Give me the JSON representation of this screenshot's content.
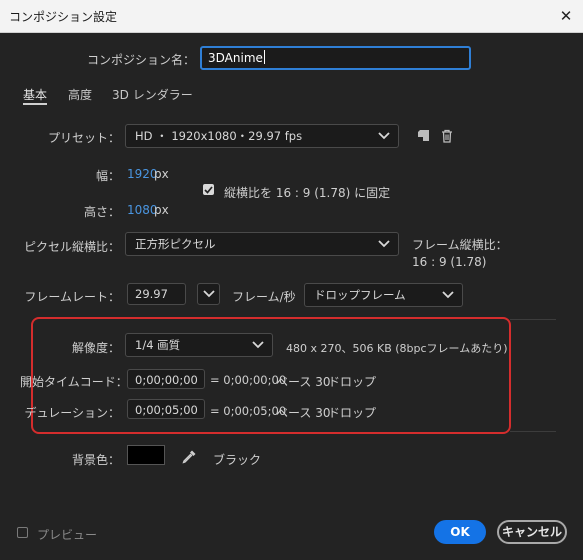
{
  "window": {
    "title": "コンポジション設定"
  },
  "comp_name": {
    "label": "コンポジション名：",
    "value": "3DAnime"
  },
  "tabs": [
    {
      "label": "基本",
      "active": true
    },
    {
      "label": "高度",
      "active": false
    },
    {
      "label": "3D レンダラー",
      "active": false
    }
  ],
  "preset": {
    "label": "プリセット：",
    "value": "HD ・ 1920x1080・29.97 fps"
  },
  "width": {
    "label": "幅：",
    "value": "1920",
    "unit": "px"
  },
  "height": {
    "label": "高さ：",
    "value": "1080",
    "unit": "px"
  },
  "lock_aspect": {
    "label": "縦横比を 16 : 9 (1.78) に固定",
    "checked": true
  },
  "pixel_aspect": {
    "label": "ピクセル縦横比：",
    "value": "正方形ピクセル"
  },
  "frame_aspect": {
    "label": "フレーム縦横比：",
    "value": "16 : 9 (1.78)"
  },
  "frame_rate": {
    "label": "フレームレート：",
    "value": "29.97",
    "unit": "フレーム/秒",
    "drop": "ドロップフレーム"
  },
  "resolution": {
    "label": "解像度：",
    "value": "1/4 画質",
    "info": "480 x 270、506 KB (8bpcフレームあたり)"
  },
  "start_tc": {
    "label": "開始タイムコード：",
    "value": "0;00;00;00",
    "readout": "= 0;00;00;00",
    "base": "ベース 30",
    "drop": "ドロップ"
  },
  "duration": {
    "label": "デュレーション：",
    "value": "0;00;05;00",
    "readout": "= 0;00;05;00",
    "base": "ベース 30",
    "drop": "ドロップ"
  },
  "bg_color": {
    "label": "背景色：",
    "name": "ブラック",
    "color": "#000000"
  },
  "preview": {
    "label": "プレビュー",
    "checked": false
  },
  "buttons": {
    "ok": "OK",
    "cancel": "キャンセル"
  },
  "colors": {
    "accent": "#1473e6",
    "highlight": "#d42d2d",
    "value_blue": "#4a95e0"
  }
}
